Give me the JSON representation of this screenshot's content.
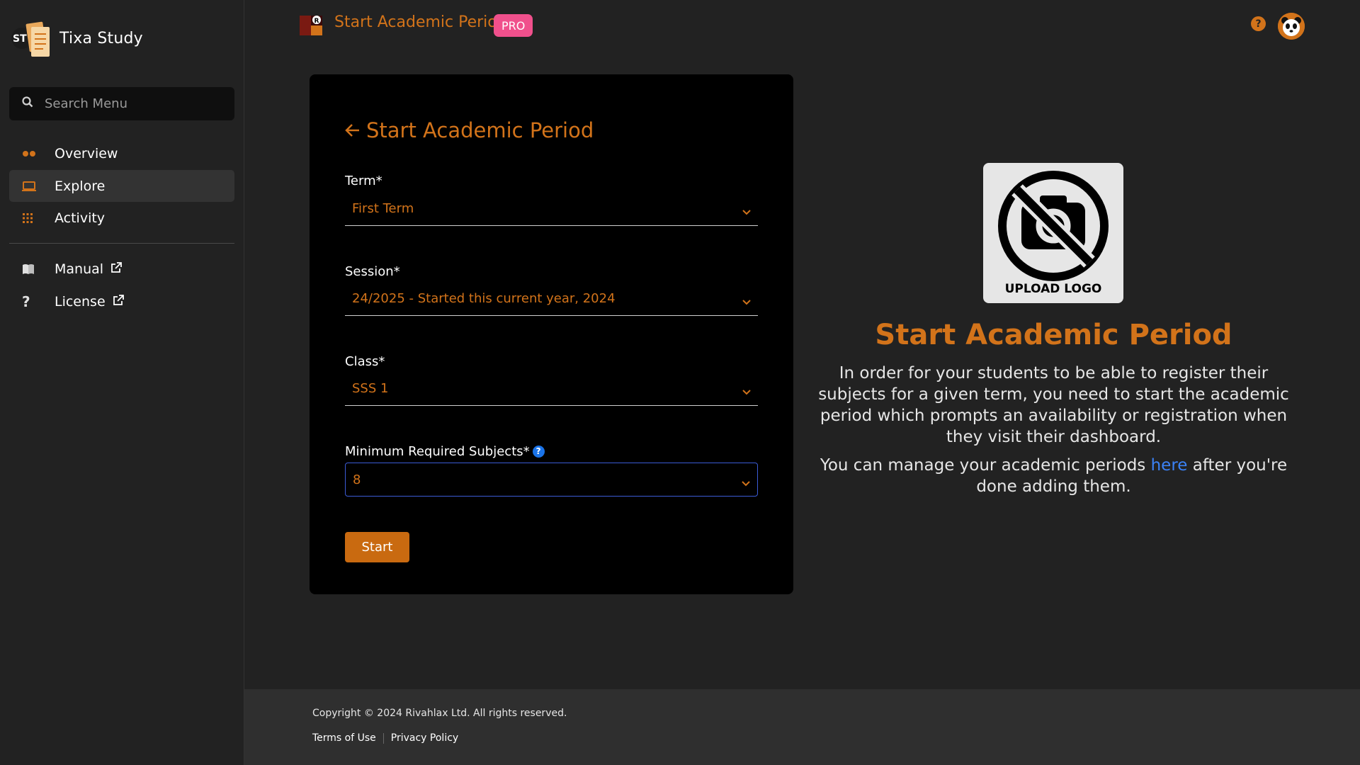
{
  "app": {
    "brand_name": "Tixa Study",
    "brand_initials": "ST"
  },
  "sidebar": {
    "search_placeholder": "Search Menu",
    "items": [
      {
        "label": "Overview",
        "icon": "dots-icon"
      },
      {
        "label": "Explore",
        "icon": "laptop-icon",
        "active": true
      },
      {
        "label": "Activity",
        "icon": "grid-icon"
      }
    ],
    "secondary": [
      {
        "label": "Manual",
        "icon": "book-icon"
      },
      {
        "label": "License",
        "icon": "question-icon"
      }
    ]
  },
  "header": {
    "title": "Start Academic Period",
    "badge": "PRO"
  },
  "form": {
    "title": "Start Academic Period",
    "term_label": "Term*",
    "term_value": "First Term",
    "session_label": "Session*",
    "session_value": "24/2025 - Started this current year, 2024",
    "class_label": "Class*",
    "class_value": "SSS 1",
    "min_subjects_label": "Minimum Required Subjects*",
    "min_subjects_value": "8",
    "start_label": "Start"
  },
  "info": {
    "logo_text": "UPLOAD LOGO",
    "title": "Start Academic Period",
    "description": "In order for your students to be able to register their subjects for a given term, you need to start the academic period which prompts an availability or registration when they visit their dashboard.",
    "manage_prefix": "You can manage your academic periods ",
    "manage_link": "here",
    "manage_suffix": " after you're done adding them."
  },
  "footer": {
    "copyright": "Copyright © 2024 Rivahlax Ltd. All rights reserved.",
    "terms": "Terms of Use",
    "privacy": "Privacy Policy"
  },
  "colors": {
    "accent": "#d2731a",
    "badge": "#f0508c",
    "link": "#3b82f6",
    "background": "#222222"
  }
}
